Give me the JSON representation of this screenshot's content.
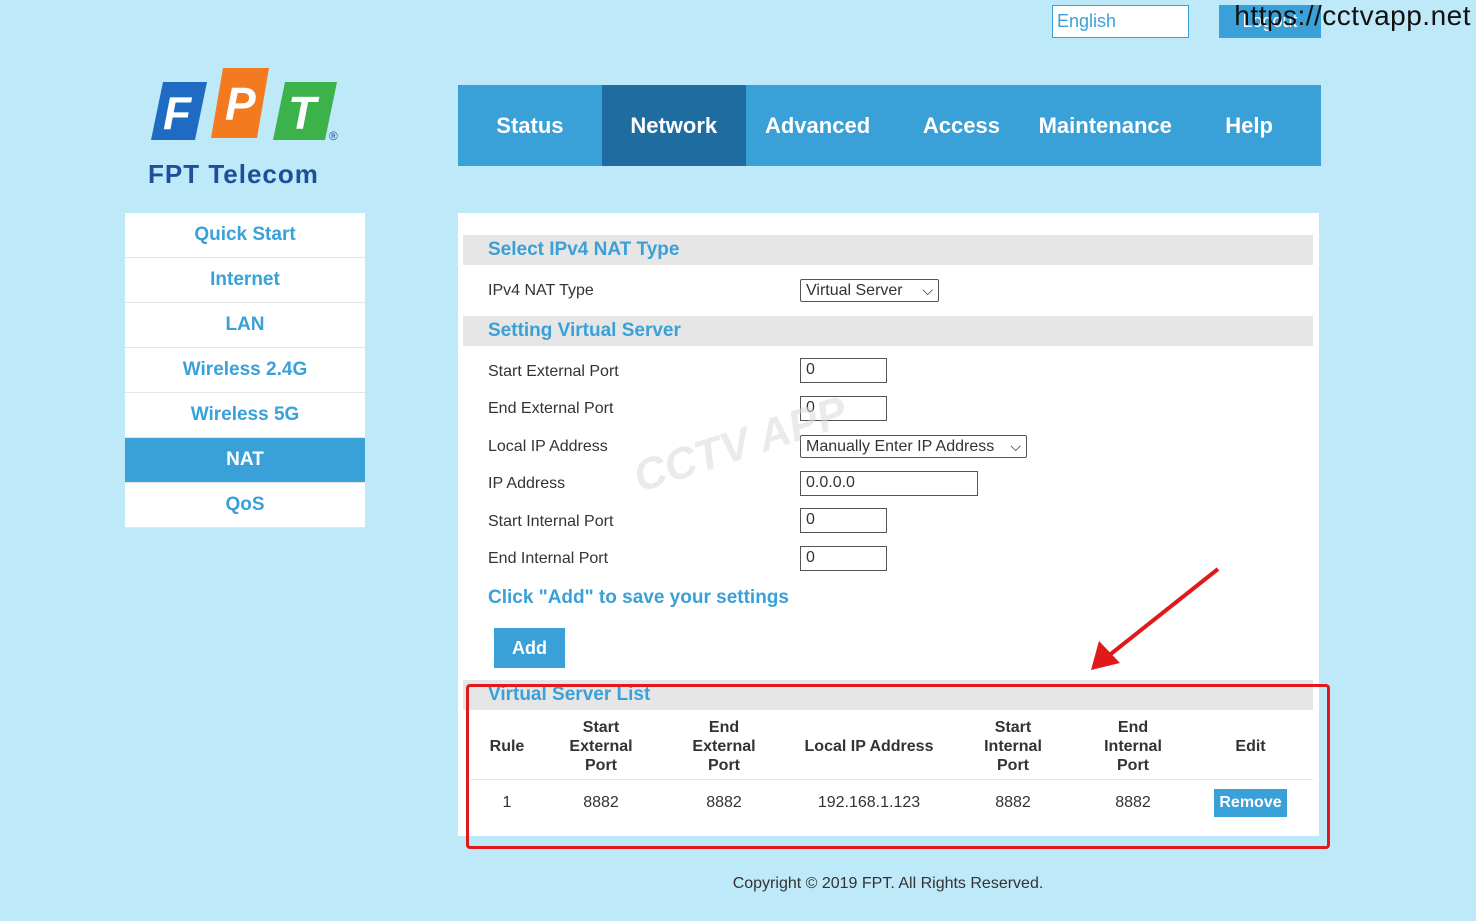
{
  "top": {
    "language": "English",
    "logout_label": "Logout",
    "site_url": "https://cctvapp.net"
  },
  "logo": {
    "letters": [
      "F",
      "P",
      "T"
    ],
    "registered": "®",
    "caption": "FPT Telecom",
    "colors": {
      "f": "#1f6bc4",
      "p": "#f47a20",
      "t": "#3bb34a"
    }
  },
  "nav": {
    "tabs": [
      {
        "label": "Status",
        "active": false
      },
      {
        "label": "Network",
        "active": true
      },
      {
        "label": "Advanced",
        "active": false
      },
      {
        "label": "Access",
        "active": false
      },
      {
        "label": "Maintenance",
        "active": false
      },
      {
        "label": "Help",
        "active": false
      }
    ]
  },
  "sidebar": {
    "items": [
      {
        "label": "Quick Start"
      },
      {
        "label": "Internet"
      },
      {
        "label": "LAN"
      },
      {
        "label": "Wireless 2.4G"
      },
      {
        "label": "Wireless 5G"
      },
      {
        "label": "NAT",
        "active": true
      },
      {
        "label": "QoS"
      }
    ]
  },
  "nat": {
    "section_title": "Select IPv4 NAT Type",
    "type_label": "IPv4 NAT Type",
    "type_value": "Virtual Server"
  },
  "vs": {
    "section_title": "Setting Virtual Server",
    "start_ext_label": "Start External Port",
    "start_ext_value": "0",
    "end_ext_label": "End External Port",
    "end_ext_value": "0",
    "local_ip_label": "Local IP Address",
    "local_ip_value": "Manually Enter IP Address",
    "ip_label": "IP Address",
    "ip_value": "0.0.0.0",
    "start_int_label": "Start Internal Port",
    "start_int_value": "0",
    "end_int_label": "End Internal Port",
    "end_int_value": "0",
    "hint": "Click \"Add\" to save your settings",
    "add_label": "Add"
  },
  "list": {
    "section_title": "Virtual Server List",
    "headers": {
      "rule": "Rule",
      "start_ext": [
        "Start",
        "External",
        "Port"
      ],
      "end_ext": [
        "End",
        "External",
        "Port"
      ],
      "local_ip": "Local IP Address",
      "start_int": [
        "Start",
        "Internal",
        "Port"
      ],
      "end_int": [
        "End",
        "Internal",
        "Port"
      ],
      "edit": "Edit"
    },
    "rows": [
      {
        "rule": "1",
        "start_ext": "8882",
        "end_ext": "8882",
        "local_ip": "192.168.1.123",
        "start_int": "8882",
        "end_int": "8882",
        "action": "Remove"
      }
    ]
  },
  "footer": {
    "copyright": "Copyright © 2019 FPT. All Rights Reserved."
  },
  "watermark": "CCTV APP",
  "colors": {
    "accent": "#3aa0d8",
    "nav_active": "#1f6da0",
    "background": "#bde9f8",
    "annotation": "#e01a1a"
  }
}
